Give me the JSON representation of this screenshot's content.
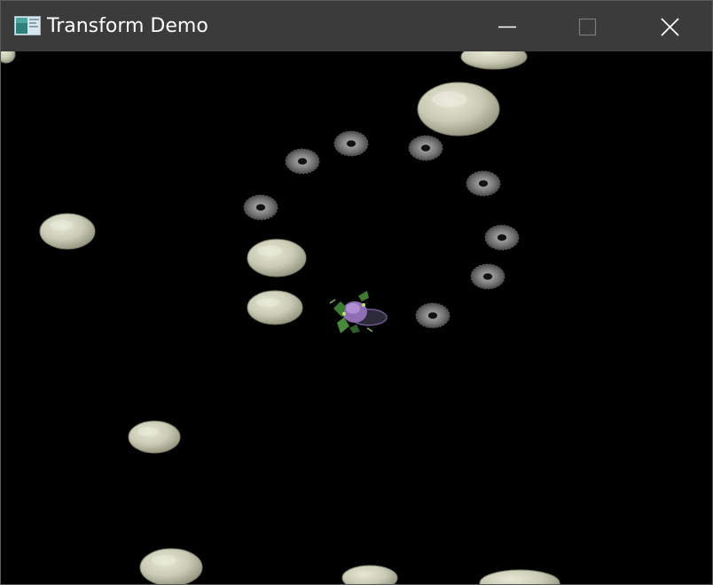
{
  "window": {
    "title": "Transform Demo",
    "icon": "app-window-icon",
    "controls": [
      "minimize-icon",
      "maximize-icon",
      "close-icon"
    ]
  },
  "scene": {
    "background": "#000000",
    "sprites": [
      "boulder",
      "sawblade",
      "character"
    ]
  }
}
